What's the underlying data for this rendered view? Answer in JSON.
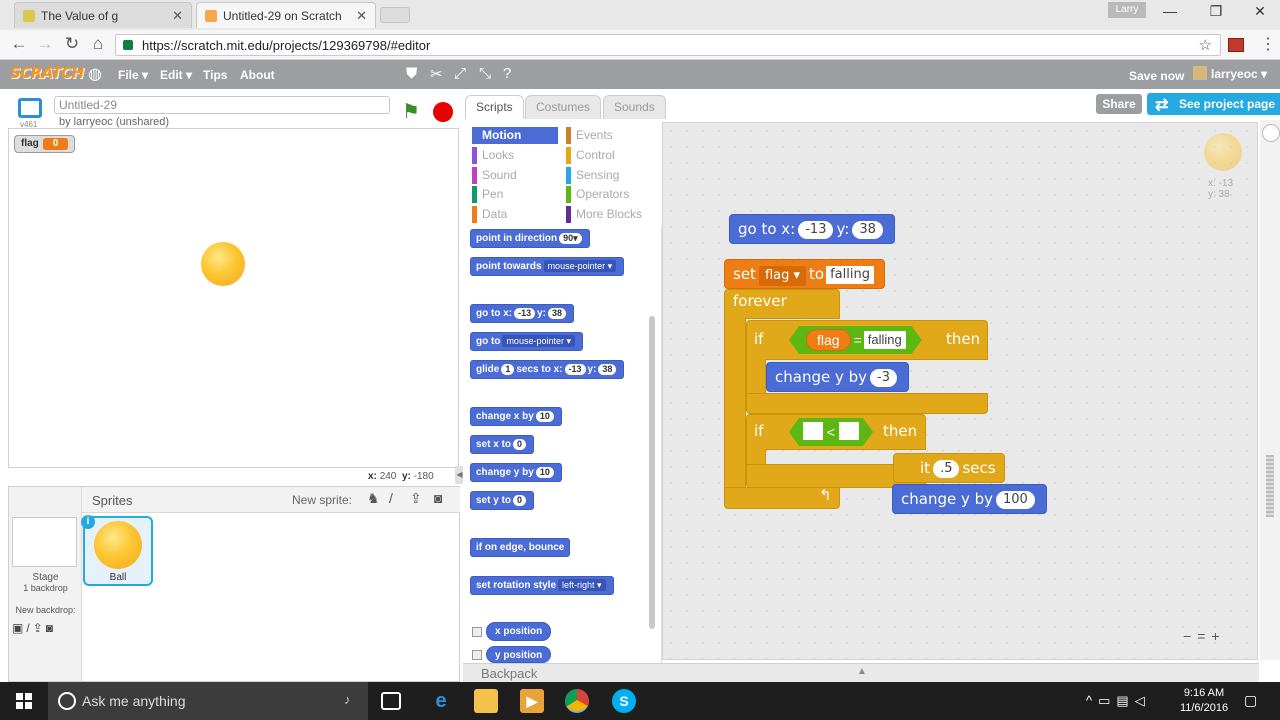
{
  "browser": {
    "tabs": [
      {
        "title": "The Value of g",
        "close": "✕"
      },
      {
        "title": "Untitled-29 on Scratch",
        "close": "✕"
      }
    ],
    "profile_name": "Larry",
    "url": "https://scratch.mit.edu/projects/129369798/#editor",
    "window_controls": {
      "minimize": "—",
      "maximize": "❐",
      "close": "✕"
    }
  },
  "scratch_menu": {
    "logo": "SCRATCH",
    "items": [
      "File ▾",
      "Edit ▾",
      "Tips",
      "About"
    ],
    "save_now": "Save now",
    "username": "larryeoc ▾"
  },
  "project": {
    "title": "Untitled-29",
    "byline": "by larryeoc (unshared)",
    "version": "v461"
  },
  "stage": {
    "variable_monitor": {
      "name": "flag",
      "value": "0"
    },
    "coords": {
      "x_label": "x:",
      "x": "240",
      "y_label": "y:",
      "y": "-180"
    }
  },
  "sprites": {
    "header": "Sprites",
    "new_sprite": "New sprite:",
    "stage_label": "Stage",
    "backdrop_count": "1 backdrop",
    "new_backdrop": "New backdrop:",
    "sprite_name": "Ball",
    "info": "i"
  },
  "editor_tabs": [
    "Scripts",
    "Costumes",
    "Sounds"
  ],
  "share": "Share",
  "see_project": "See project page",
  "categories": [
    {
      "label": "Motion",
      "color": "#4a6cd4"
    },
    {
      "label": "Events",
      "color": "#c88330"
    },
    {
      "label": "Looks",
      "color": "#8a55d7"
    },
    {
      "label": "Control",
      "color": "#e1a91a"
    },
    {
      "label": "Sound",
      "color": "#bb42c3"
    },
    {
      "label": "Sensing",
      "color": "#2ca5e2"
    },
    {
      "label": "Pen",
      "color": "#0e9a6c"
    },
    {
      "label": "Operators",
      "color": "#5cb712"
    },
    {
      "label": "Data",
      "color": "#ee7d16"
    },
    {
      "label": "More Blocks",
      "color": "#632d99"
    }
  ],
  "palette": {
    "point_dir": {
      "label": "point in direction",
      "val": "90▾"
    },
    "point_towards": {
      "label": "point towards",
      "val": "mouse-pointer ▾"
    },
    "goto_xy": {
      "a": "go to x:",
      "x": "-13",
      "b": "y:",
      "y": "38"
    },
    "goto": {
      "label": "go to",
      "val": "mouse-pointer ▾"
    },
    "glide": {
      "a": "glide",
      "secs": "1",
      "b": "secs to x:",
      "x": "-13",
      "c": "y:",
      "y": "38"
    },
    "change_x": {
      "label": "change x by",
      "val": "10"
    },
    "set_x": {
      "label": "set x to",
      "val": "0"
    },
    "change_y": {
      "label": "change y by",
      "val": "10"
    },
    "set_y": {
      "label": "set y to",
      "val": "0"
    },
    "bounce": {
      "label": "if on edge, bounce"
    },
    "rotation": {
      "label": "set rotation style",
      "val": "left-right ▾"
    },
    "x_position": "x position",
    "y_position": "y position"
  },
  "backpack": {
    "label": "Backpack",
    "arrow": "▲"
  },
  "script": {
    "goto": {
      "a": "go to x:",
      "x": "-13",
      "b": "y:",
      "y": "38"
    },
    "set": {
      "a": "set",
      "var": "flag ▾",
      "b": "to",
      "val": "falling"
    },
    "forever": "forever",
    "if1": {
      "if": "if",
      "var": "flag",
      "eq": "=",
      "val": "falling",
      "then": "then"
    },
    "change_y": {
      "label": "change y by",
      "val": "-3"
    },
    "if2": {
      "if": "if",
      "lt": "<",
      "then": "then"
    },
    "wait": {
      "label": "it",
      "val": ".5",
      "secs": "secs"
    },
    "change_y2": {
      "label": "change y by",
      "val": "100"
    },
    "loop_arrow": "↰"
  },
  "sprite_info": {
    "x": "x: -13",
    "y": "y: 38"
  },
  "zoom": {
    "out": "🔍",
    "reset": "=",
    "in": "🔍"
  },
  "taskbar": {
    "search": "Ask me anything",
    "time": "9:16 AM",
    "date": "11/6/2016"
  }
}
